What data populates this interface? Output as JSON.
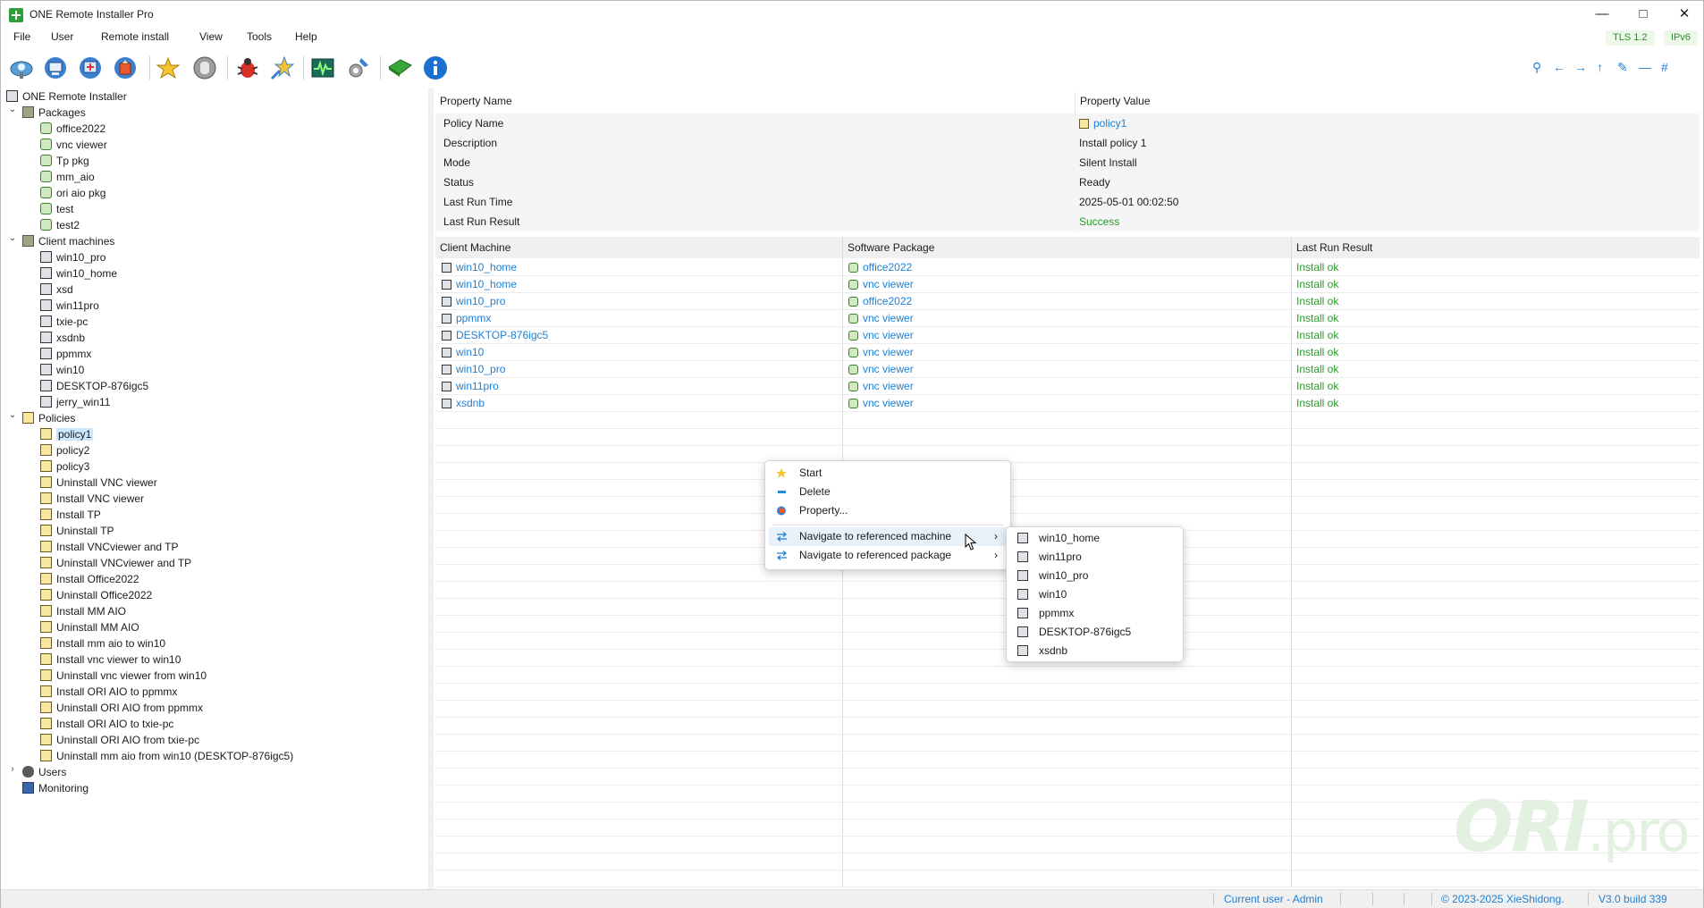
{
  "app": {
    "title": "ONE Remote Installer Pro"
  },
  "menu": {
    "items": [
      "File",
      "User",
      "Remote install",
      "View",
      "Tools",
      "Help"
    ]
  },
  "badges": {
    "tls": "TLS 1.2",
    "ipv6": "IPv6"
  },
  "toolbar": {
    "icons": [
      "discover-icon",
      "client-icon",
      "deploy-icon",
      "policy-icon",
      "star-icon",
      "stop-icon",
      "bug-icon",
      "wizard-icon",
      "monitor-icon",
      "settings-icon",
      "package-icon",
      "info-icon"
    ],
    "right_icons": [
      "search-icon",
      "back-icon",
      "forward-icon",
      "up-icon",
      "edit-icon",
      "minus-icon",
      "hash-icon"
    ]
  },
  "tree": {
    "root": "ONE Remote Installer",
    "packages": {
      "label": "Packages",
      "items": [
        "office2022",
        "vnc viewer",
        "Tp pkg",
        "mm_aio",
        "ori aio pkg",
        "test",
        "test2"
      ]
    },
    "clients": {
      "label": "Client machines",
      "items": [
        "win10_pro",
        "win10_home",
        "xsd",
        "win11pro",
        "txie-pc",
        "xsdnb",
        "ppmmx",
        "win10",
        "DESKTOP-876igc5",
        "jerry_win11"
      ]
    },
    "policies": {
      "label": "Policies",
      "items": [
        "policy1",
        "policy2",
        "policy3",
        "Uninstall VNC viewer",
        "Install VNC viewer",
        "Install TP",
        "Uninstall TP",
        "Install VNCviewer and TP",
        "Uninstall VNCviewer and TP",
        "Install Office2022",
        "Uninstall Office2022",
        "Install MM AIO",
        "Uninstall MM AIO",
        "Install mm aio to win10",
        "Install vnc viewer to win10",
        "Uninstall vnc viewer from win10",
        "Install ORI AIO to ppmmx",
        "Uninstall ORI AIO from ppmmx",
        "Install ORI AIO to txie-pc",
        "Uninstall ORI AIO from txie-pc",
        "Uninstall mm aio from win10 (DESKTOP-876igc5)"
      ]
    },
    "users": "Users",
    "monitoring": "Monitoring"
  },
  "properties": {
    "header_name": "Property Name",
    "header_value": "Property Value",
    "rows": [
      {
        "name": "Policy Name",
        "value": "policy1"
      },
      {
        "name": "Description",
        "value": "Install policy 1"
      },
      {
        "name": "Mode",
        "value": "Silent Install"
      },
      {
        "name": "Status",
        "value": "Ready"
      },
      {
        "name": "Last Run Time",
        "value": "2025-05-01 00:02:50"
      },
      {
        "name": "Last Run Result",
        "value": "Success"
      }
    ]
  },
  "table": {
    "headers": [
      "Client Machine",
      "Software Package",
      "Last Run Result"
    ],
    "rows": [
      {
        "machine": "win10_home",
        "package": "office2022",
        "result": "Install ok"
      },
      {
        "machine": "win10_home",
        "package": "vnc viewer",
        "result": "Install ok"
      },
      {
        "machine": "win10_pro",
        "package": "office2022",
        "result": "Install ok"
      },
      {
        "machine": "ppmmx",
        "package": "vnc viewer",
        "result": "Install ok"
      },
      {
        "machine": "DESKTOP-876igc5",
        "package": "vnc viewer",
        "result": "Install ok"
      },
      {
        "machine": "win10",
        "package": "vnc viewer",
        "result": "Install ok"
      },
      {
        "machine": "win10_pro",
        "package": "vnc viewer",
        "result": "Install ok"
      },
      {
        "machine": "win11pro",
        "package": "vnc viewer",
        "result": "Install ok"
      },
      {
        "machine": "xsdnb",
        "package": "vnc viewer",
        "result": "Install ok"
      }
    ]
  },
  "context_menu": {
    "items": [
      "Start",
      "Delete",
      "Property...",
      "Navigate to referenced machine",
      "Navigate to referenced package"
    ],
    "submenu": [
      "win10_home",
      "win11pro",
      "win10_pro",
      "win10",
      "ppmmx",
      "DESKTOP-876igc5",
      "xsdnb"
    ]
  },
  "watermark": {
    "main": "ORI",
    "suffix": ".pro"
  },
  "status": {
    "user": "Current user - Admin",
    "copyright": "© 2023-2025 XieShidong.",
    "version": "V3.0 build 339"
  },
  "colors": {
    "link": "#1f7fd1",
    "success": "#2a9a2a",
    "selection": "#cce8ff",
    "accent_green": "#2e9e3a"
  }
}
